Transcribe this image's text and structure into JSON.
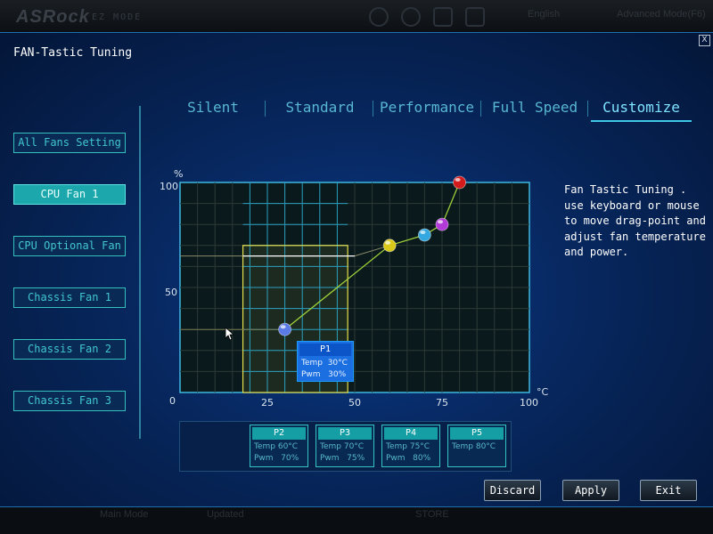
{
  "background": {
    "brand": "ASRock",
    "brand_sub": "EZ MODE",
    "language": "English",
    "mode": "Advanced Mode(F6)",
    "bottom_left": "Main Mode",
    "bottom_mid": "Updated",
    "bottom_right": "STORE"
  },
  "dialog": {
    "title": "FAN-Tastic Tuning",
    "close": "X"
  },
  "tabs": [
    "Silent",
    "Standard",
    "Performance",
    "Full Speed",
    "Customize"
  ],
  "active_tab": "Customize",
  "fans": [
    {
      "label": "All Fans Setting",
      "active": false
    },
    {
      "label": "CPU Fan 1",
      "active": true
    },
    {
      "label": "CPU Optional Fan",
      "active": false
    },
    {
      "label": "Chassis Fan 1",
      "active": false
    },
    {
      "label": "Chassis Fan 2",
      "active": false
    },
    {
      "label": "Chassis Fan 3",
      "active": false
    }
  ],
  "chart": {
    "y_unit": "%",
    "x_unit": "°C",
    "y_ticks": [
      "100",
      "50",
      "0"
    ],
    "x_ticks": [
      "25",
      "50",
      "75",
      "100"
    ]
  },
  "chart_data": {
    "type": "line",
    "xlabel": "°C",
    "ylabel": "%",
    "xlim": [
      0,
      100
    ],
    "ylim": [
      0,
      100
    ],
    "grid": true,
    "points": [
      {
        "name": "P1",
        "x": 30,
        "y": 30,
        "color": "#5a7ae6"
      },
      {
        "name": "P2",
        "x": 60,
        "y": 70,
        "color": "#d8c81a"
      },
      {
        "name": "P3",
        "x": 70,
        "y": 75,
        "color": "#33a8e0"
      },
      {
        "name": "P4",
        "x": 75,
        "y": 80,
        "color": "#b23ad8"
      },
      {
        "name": "P5",
        "x": 80,
        "y": 100,
        "color": "#d41c1c"
      }
    ],
    "reference_line": [
      [
        0,
        65
      ],
      [
        50,
        65
      ],
      [
        60,
        70
      ]
    ]
  },
  "p1_tooltip": {
    "name": "P1",
    "temp": "Temp  30°C",
    "pwm": "Pwm   30%"
  },
  "point_boxes": [
    {
      "name": "P2",
      "temp": "Temp 60°C",
      "pwm": "Pwm   70%"
    },
    {
      "name": "P3",
      "temp": "Temp 70°C",
      "pwm": "Pwm   75%"
    },
    {
      "name": "P4",
      "temp": "Temp 75°C",
      "pwm": "Pwm   80%"
    },
    {
      "name": "P5",
      "temp": "Temp 80°C",
      "pwm": ""
    }
  ],
  "help_text": "Fan Tastic Tuning . use keyboard or mouse to move drag-point and adjust fan temperature and power.",
  "buttons": {
    "discard": "Discard",
    "apply": "Apply",
    "exit": "Exit"
  }
}
